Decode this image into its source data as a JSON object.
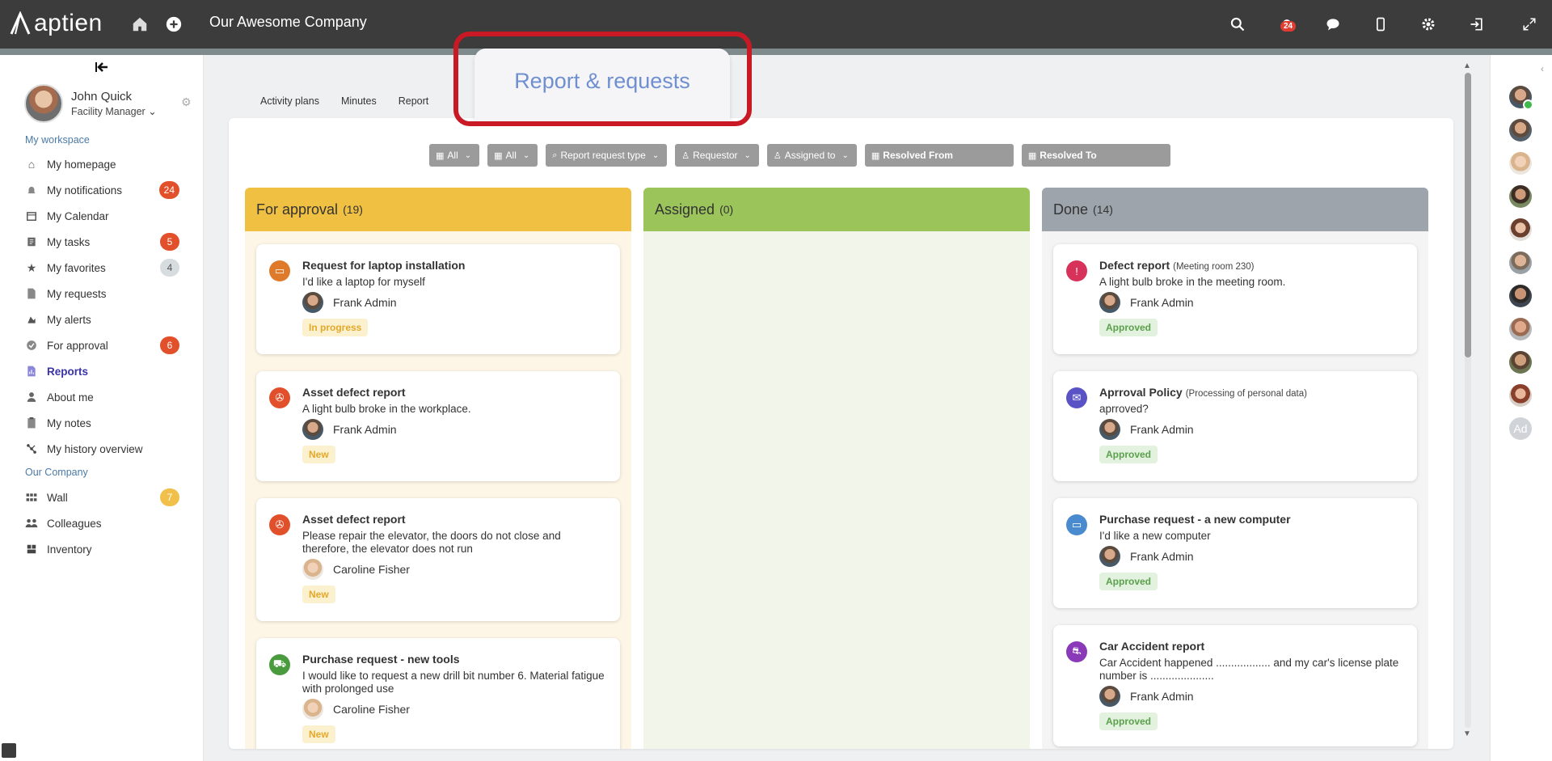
{
  "app": {
    "logo_text": "aptien",
    "company": "Our Awesome Company",
    "notifications_badge": "24"
  },
  "user": {
    "name": "John Quick",
    "role": "Facility Manager"
  },
  "sidebar": {
    "workspace_label": "My workspace",
    "company_label": "Our Company",
    "workspace_items": [
      {
        "label": "My homepage",
        "icon": "home-icon"
      },
      {
        "label": "My notifications",
        "icon": "bell-icon",
        "count": "24"
      },
      {
        "label": "My Calendar",
        "icon": "calendar-icon"
      },
      {
        "label": "My tasks",
        "icon": "tasks-icon",
        "count": "5"
      },
      {
        "label": "My favorites",
        "icon": "star-icon",
        "count": "4"
      },
      {
        "label": "My requests",
        "icon": "document-icon"
      },
      {
        "label": "My alerts",
        "icon": "alert-icon"
      },
      {
        "label": "For approval",
        "icon": "check-circle-icon",
        "count": "6"
      },
      {
        "label": "Reports",
        "icon": "report-icon"
      },
      {
        "label": "About me",
        "icon": "person-icon"
      },
      {
        "label": "My notes",
        "icon": "notes-icon"
      },
      {
        "label": "My history overview",
        "icon": "history-icon"
      }
    ],
    "company_items": [
      {
        "label": "Wall",
        "icon": "wall-icon",
        "count": "7"
      },
      {
        "label": "Colleagues",
        "icon": "colleagues-icon"
      },
      {
        "label": "Inventory",
        "icon": "inventory-icon"
      }
    ]
  },
  "tabs": [
    "Activity plans",
    "Minutes",
    "Report"
  ],
  "popup": {
    "title": "Report & requests"
  },
  "filters": [
    {
      "label": "All",
      "icon": "calendar-icon"
    },
    {
      "label": "All",
      "icon": "calendar-icon"
    },
    {
      "label": "Report request type",
      "icon": "search-icon"
    },
    {
      "label": "Requestor",
      "icon": "person-icon"
    },
    {
      "label": "Assigned to",
      "icon": "person-icon"
    },
    {
      "label": "Resolved From",
      "icon": "calendar-icon"
    },
    {
      "label": "Resolved To",
      "icon": "calendar-icon"
    }
  ],
  "columns": [
    {
      "title": "For approval",
      "count": "(19)",
      "cards": [
        {
          "title": "Request for laptop installation",
          "sub": "",
          "desc": "I'd like a laptop for myself",
          "user": "Frank Admin",
          "status": "In progress",
          "icon": "laptop-icon",
          "icon_color": "#e07a2b"
        },
        {
          "title": "Asset defect report",
          "sub": "",
          "desc": "A light bulb broke in the workplace.",
          "user": "Frank Admin",
          "status": "New",
          "icon": "defect-icon",
          "icon_color": "#e2502b"
        },
        {
          "title": "Asset defect report",
          "sub": "",
          "desc": "Please repair the elevator, the doors do not close and therefore, the elevator does not run",
          "user": "Caroline Fisher",
          "status": "New",
          "icon": "defect-icon",
          "icon_color": "#e2502b"
        },
        {
          "title": "Purchase request - new tools",
          "sub": "",
          "desc": "I would like to request a new drill bit number 6. Material fatigue with prolonged use",
          "user": "Caroline Fisher",
          "status": "New",
          "icon": "cart-icon",
          "icon_color": "#4a9a3e"
        }
      ]
    },
    {
      "title": "Assigned",
      "count": "(0)",
      "cards": []
    },
    {
      "title": "Done",
      "count": "(14)",
      "cards": [
        {
          "title": "Defect report",
          "sub": "(Meeting room 230)",
          "desc": "A light bulb broke in the meeting room.",
          "user": "Frank Admin",
          "status": "Approved",
          "icon": "warning-icon",
          "icon_color": "#d7335a"
        },
        {
          "title": "Aprroval Policy",
          "sub": "(Processing of personal data)",
          "desc": "aprroved?",
          "user": "Frank Admin",
          "status": "Approved",
          "icon": "chat-icon",
          "icon_color": "#5a53c6"
        },
        {
          "title": "Purchase request - a new computer",
          "sub": "",
          "desc": "I'd like a new computer",
          "user": "Frank Admin",
          "status": "Approved",
          "icon": "laptop-icon",
          "icon_color": "#4a8bd0"
        },
        {
          "title": "Car Accident report",
          "sub": "",
          "desc": "Car Accident happened .................. and my car's license plate number is .....................",
          "user": "Frank Admin",
          "status": "Approved",
          "icon": "car-icon",
          "icon_color": "#8a3ab8"
        }
      ]
    }
  ],
  "rail": {
    "ad_label": "Ad"
  }
}
